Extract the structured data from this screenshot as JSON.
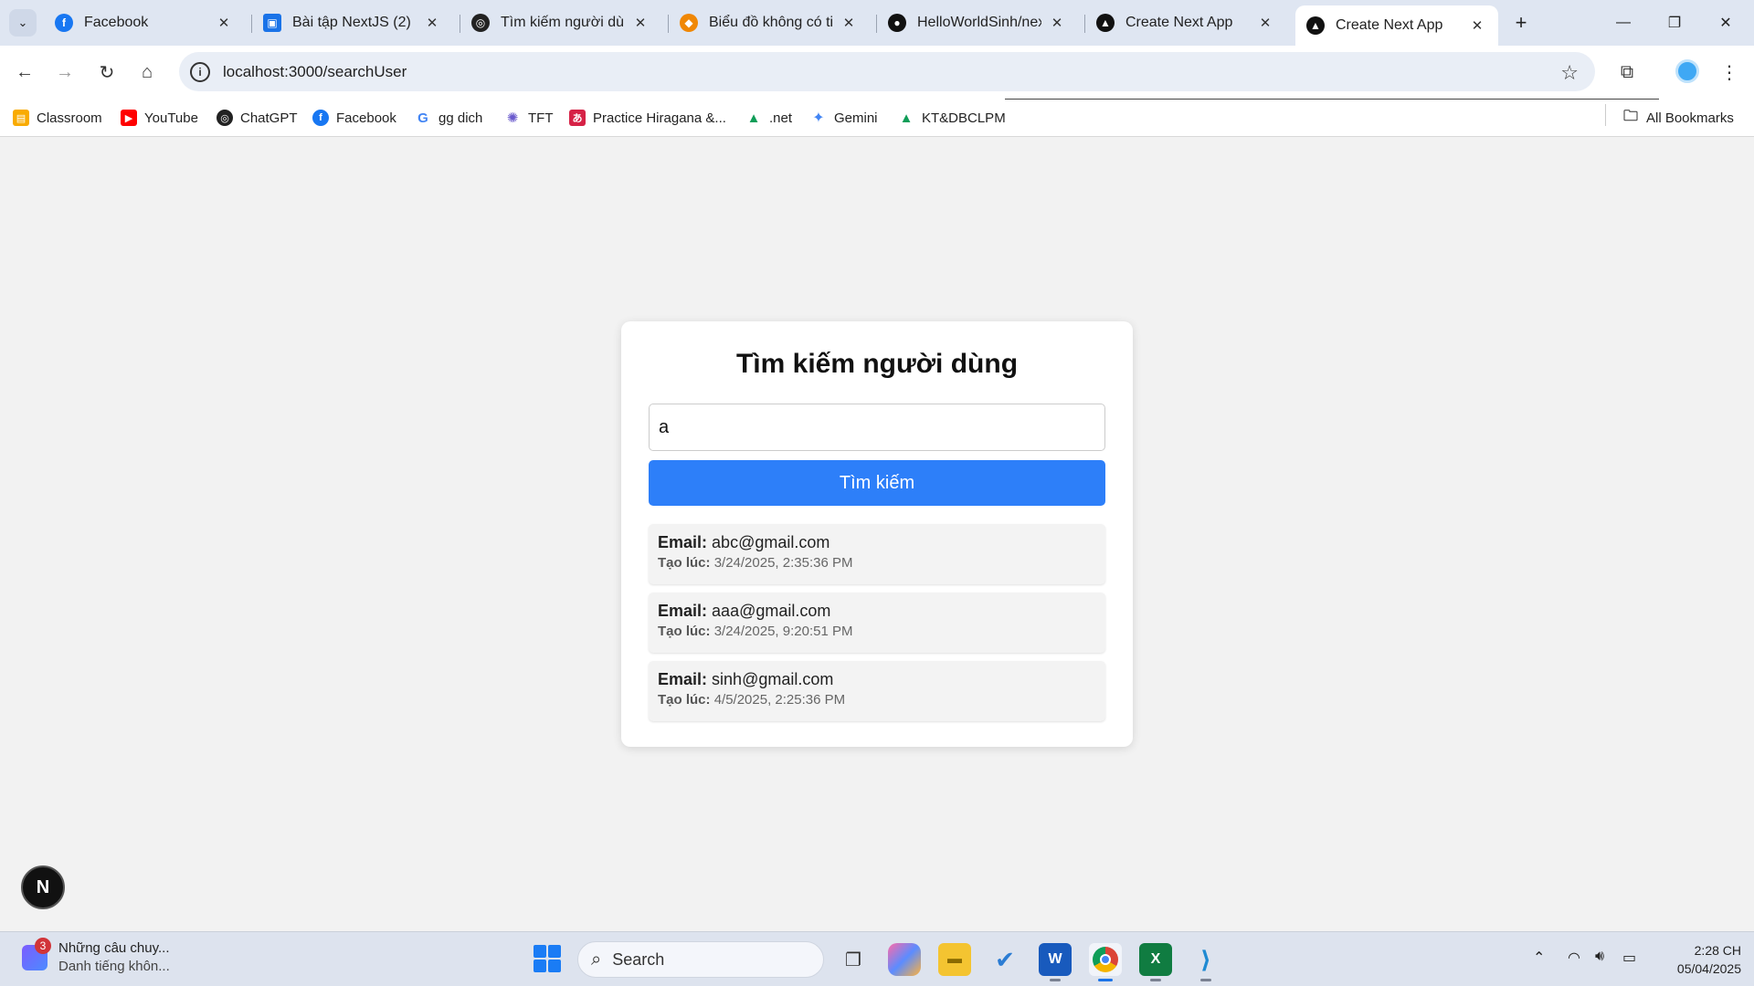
{
  "browser": {
    "tabs": [
      {
        "title": "Facebook",
        "favicon": "facebook-icon",
        "color": "#1877f2"
      },
      {
        "title": "Bài tập NextJS (2)",
        "favicon": "classroom-icon",
        "color": "#1a73e8"
      },
      {
        "title": "Tìm kiếm người dùng",
        "favicon": "chatgpt-icon",
        "color": "#222222"
      },
      {
        "title": "Biểu đồ không có tiêu đề",
        "favicon": "drawio-icon",
        "color": "#f08705"
      },
      {
        "title": "HelloWorldSinh/next",
        "favicon": "github-icon",
        "color": "#111111"
      },
      {
        "title": "Create Next App",
        "favicon": "nextjs-icon",
        "color": "#111111"
      },
      {
        "title": "Create Next App",
        "favicon": "nextjs-icon",
        "color": "#111111",
        "active": true
      }
    ],
    "url": "localhost:3000/searchUser",
    "bookmarks": [
      {
        "label": "Classroom",
        "icon": "classroom-icon",
        "color": "#f9ab00"
      },
      {
        "label": "YouTube",
        "icon": "youtube-icon",
        "color": "#ff0000"
      },
      {
        "label": "ChatGPT",
        "icon": "chatgpt-icon",
        "color": "#222222"
      },
      {
        "label": "Facebook",
        "icon": "facebook-icon",
        "color": "#1877f2"
      },
      {
        "label": "gg dich",
        "icon": "google-icon",
        "color": "#4285f4"
      },
      {
        "label": "TFT",
        "icon": "tft-icon",
        "color": "#6a5acd"
      },
      {
        "label": "Practice Hiragana &...",
        "icon": "hiragana-icon",
        "color": "#d62246"
      },
      {
        "label": ".net",
        "icon": "drive-icon",
        "color": "#0f9d58"
      },
      {
        "label": "Gemini",
        "icon": "gemini-icon",
        "color": "#4285f4"
      },
      {
        "label": "KT&DBCLPM",
        "icon": "drive-icon",
        "color": "#0f9d58"
      }
    ],
    "all_bookmarks": "All Bookmarks"
  },
  "page": {
    "title": "Tìm kiếm người dùng",
    "search_value": "a",
    "search_button": "Tìm kiếm",
    "email_label": "Email:",
    "created_label": "Tạo lúc:",
    "results": [
      {
        "email": "abc@gmail.com",
        "created": "3/24/2025, 2:35:36 PM"
      },
      {
        "email": "aaa@gmail.com",
        "created": "3/24/2025, 9:20:51 PM"
      },
      {
        "email": "sinh@gmail.com",
        "created": "4/5/2025, 2:25:36 PM"
      }
    ],
    "next_badge": "N",
    "accent_color": "#2d7ff9"
  },
  "taskbar": {
    "widget_badge": "3",
    "widget_line1": "Những câu chuy...",
    "widget_line2": "Danh tiếng khôn...",
    "search_label": "Search",
    "time": "2:28 CH",
    "date": "05/04/2025"
  }
}
